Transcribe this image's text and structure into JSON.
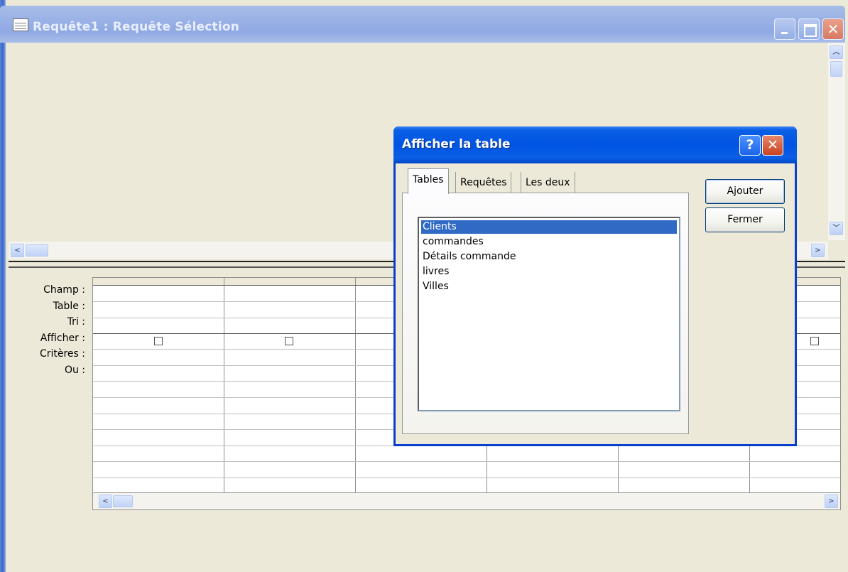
{
  "window": {
    "title": "Requête1 : Requête Sélection"
  },
  "qbe": {
    "row_labels": [
      "Champ :",
      "Table :",
      "Tri :",
      "Afficher :",
      "Critères :",
      "Ou :"
    ]
  },
  "dialog": {
    "title": "Afficher la table",
    "help_glyph": "?",
    "close_glyph": "✕",
    "tabs": [
      {
        "label": "Tables",
        "active": true
      },
      {
        "label": "Requêtes",
        "active": false
      },
      {
        "label": "Les deux",
        "active": false
      }
    ],
    "list_items": [
      "Clients",
      "commandes",
      "Détails commande",
      "livres",
      "Villes"
    ],
    "selected_item": "Clients",
    "buttons": {
      "add": "Ajouter",
      "close": "Fermer"
    }
  },
  "colors": {
    "dialog_title": "#0054e3",
    "selection": "#316ac5",
    "inactive_title": "#9db4e6"
  }
}
